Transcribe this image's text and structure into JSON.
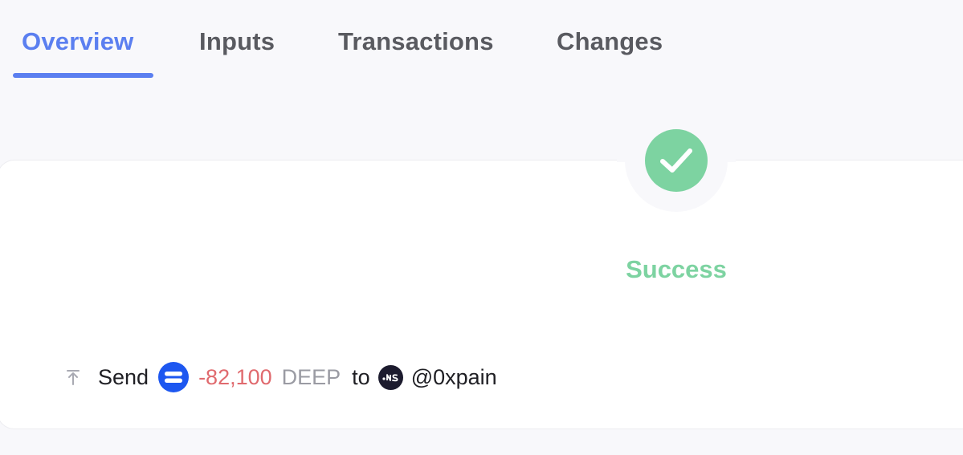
{
  "tabs": [
    {
      "label": "Overview",
      "active": true
    },
    {
      "label": "Inputs",
      "active": false
    },
    {
      "label": "Transactions",
      "active": false
    },
    {
      "label": "Changes",
      "active": false
    }
  ],
  "status": {
    "text": "Success",
    "icon": "check-icon",
    "color": "#7dd3a1"
  },
  "transfer": {
    "action": "Send",
    "amount": "-82,100",
    "symbol": "DEEP",
    "connector": "to",
    "recipient": "@0xpain",
    "action_icon": "send-upload-icon",
    "token_icon": "deep-token-icon",
    "recipient_icon": "suins-avatar-icon",
    "amount_color": "#e06a6e"
  },
  "colors": {
    "accent": "#5b7ff0",
    "token_blue": "#1d57f0"
  }
}
